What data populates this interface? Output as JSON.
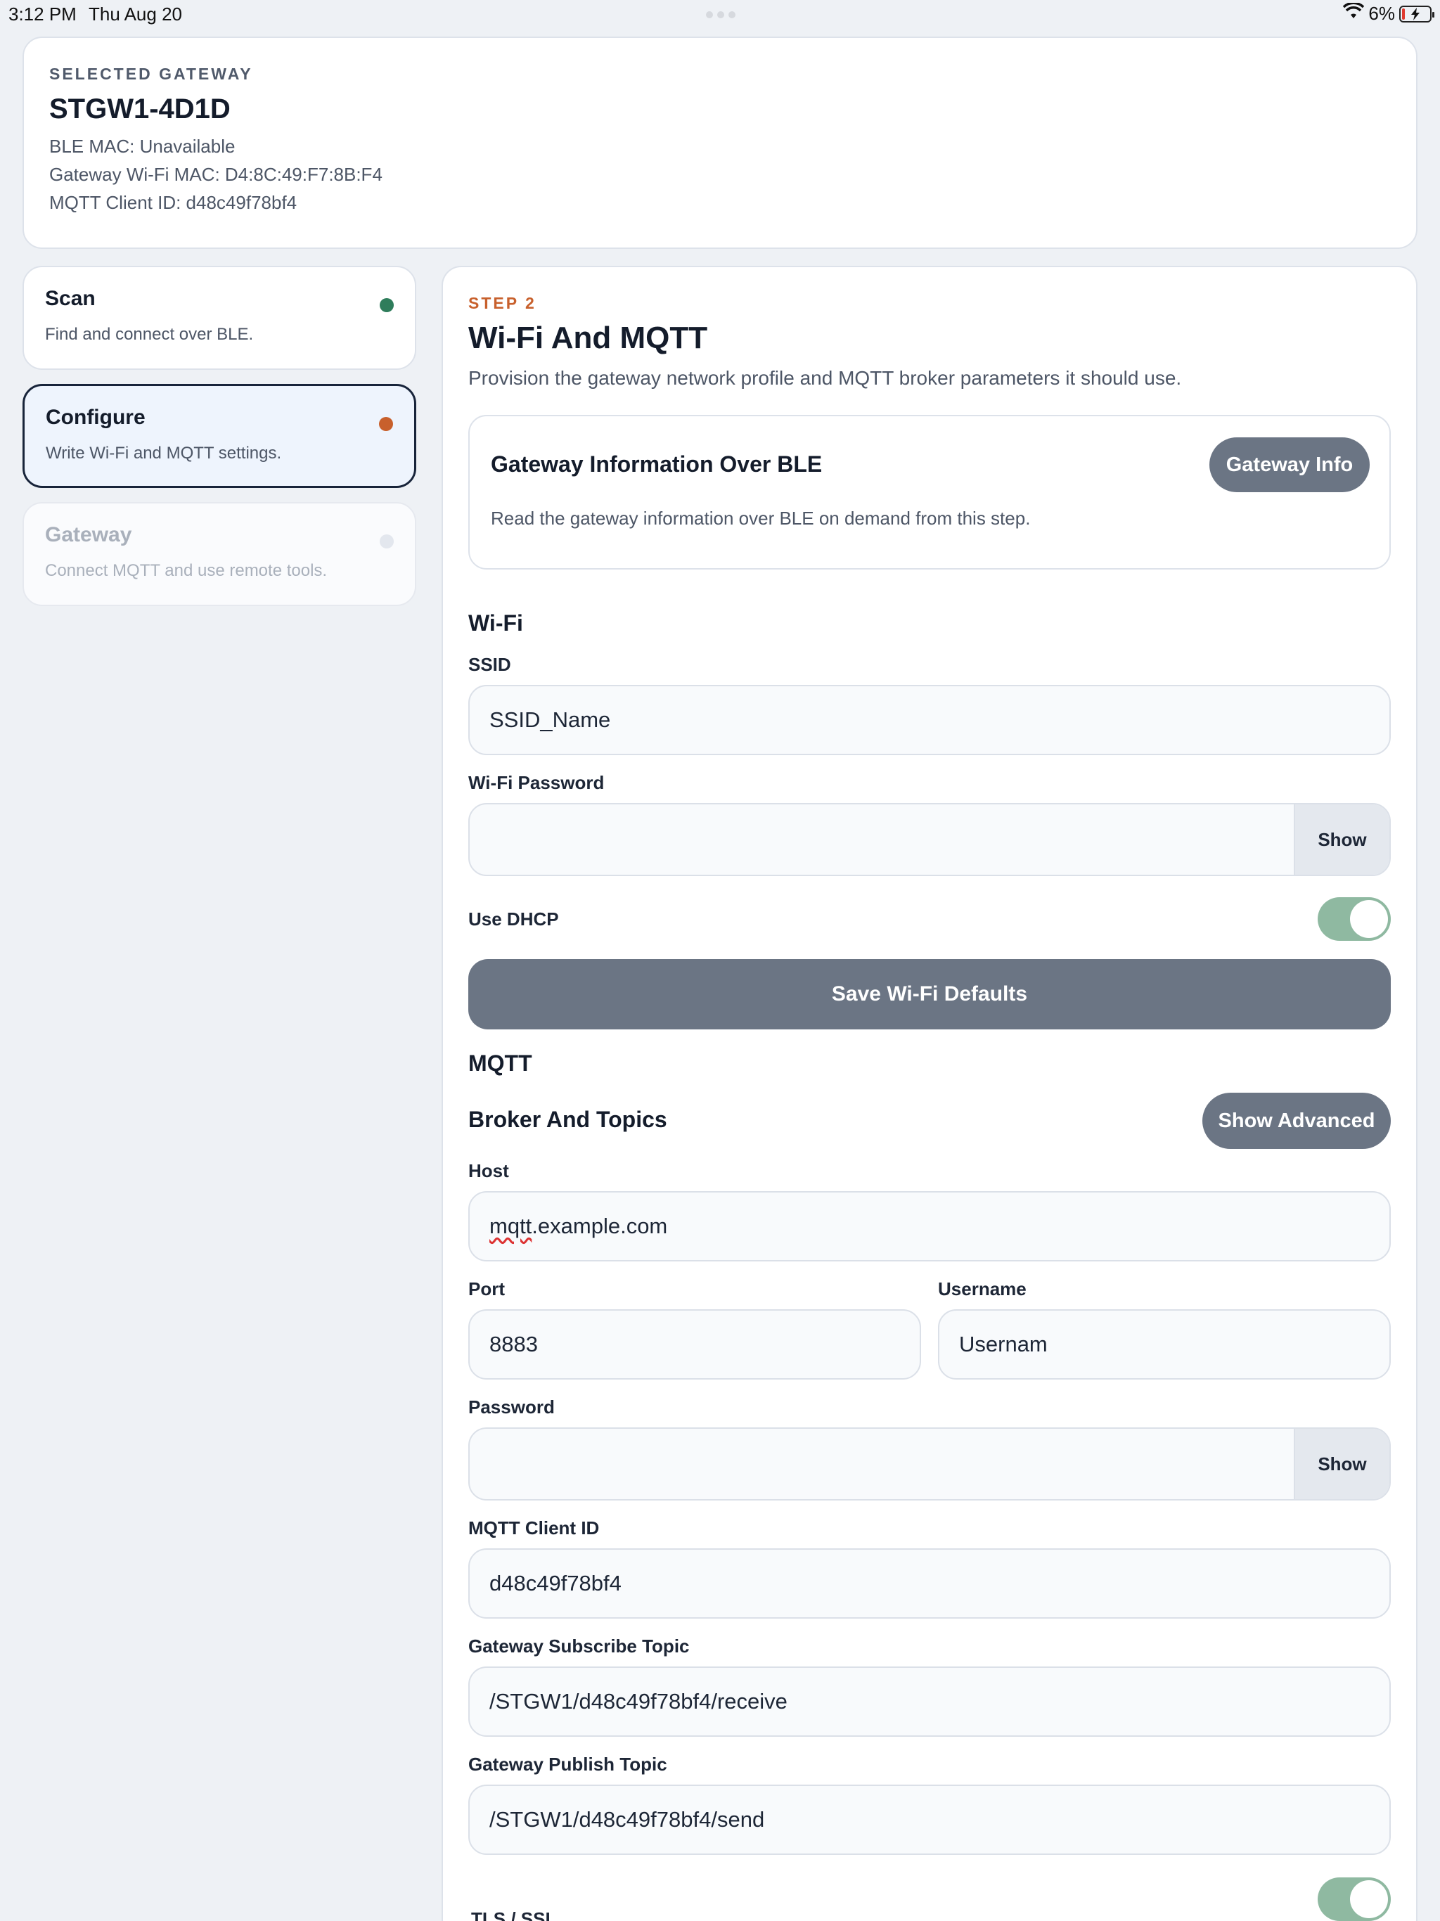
{
  "status_bar": {
    "time": "3:12 PM",
    "date": "Thu Aug 20",
    "battery": "6%"
  },
  "gateway": {
    "eyebrow": "SELECTED GATEWAY",
    "name": "STGW1-4D1D",
    "ble_mac": "BLE MAC: Unavailable",
    "wifi_mac": "Gateway Wi-Fi MAC: D4:8C:49:F7:8B:F4",
    "client_id": "MQTT Client ID: d48c49f78bf4"
  },
  "steps": [
    {
      "title": "Scan",
      "desc": "Find and connect over BLE.",
      "color": "#2f7d5b"
    },
    {
      "title": "Configure",
      "desc": "Write Wi-Fi and MQTT settings.",
      "color": "#c8602c"
    },
    {
      "title": "Gateway",
      "desc": "Connect MQTT and use remote tools.",
      "color": "#e3e7ee"
    }
  ],
  "main": {
    "step_label": "STEP 2",
    "title": "Wi-Fi And MQTT",
    "desc": "Provision the gateway network profile and MQTT broker parameters it should use.",
    "info": {
      "title": "Gateway Information Over BLE",
      "desc": "Read the gateway information over BLE on demand from this step.",
      "button": "Gateway Info"
    },
    "wifi": {
      "heading": "Wi-Fi",
      "ssid_label": "SSID",
      "ssid_value": "SSID_Name",
      "password_label": "Wi-Fi Password",
      "password_value": "",
      "show_label": "Show",
      "dhcp_label": "Use DHCP",
      "dhcp_on": true,
      "save_button": "Save Wi-Fi Defaults"
    },
    "mqtt": {
      "heading": "MQTT",
      "broker_heading": "Broker And Topics",
      "advanced_button": "Show Advanced",
      "host_label": "Host",
      "host_value_prefix": "mqtt",
      "host_value_rest": ".example.com",
      "port_label": "Port",
      "port_value": "8883",
      "username_label": "Username",
      "username_value": "Usernam",
      "password_label": "Password",
      "password_value": "",
      "show_label": "Show",
      "client_id_label": "MQTT Client ID",
      "client_id_value": "d48c49f78bf4",
      "subscribe_label": "Gateway Subscribe Topic",
      "subscribe_value": "/STGW1/d48c49f78bf4/receive",
      "publish_label": "Gateway Publish Topic",
      "publish_value": "/STGW1/d48c49f78bf4/send",
      "tls_label": "TLS / SSL",
      "tls_on": true
    }
  }
}
